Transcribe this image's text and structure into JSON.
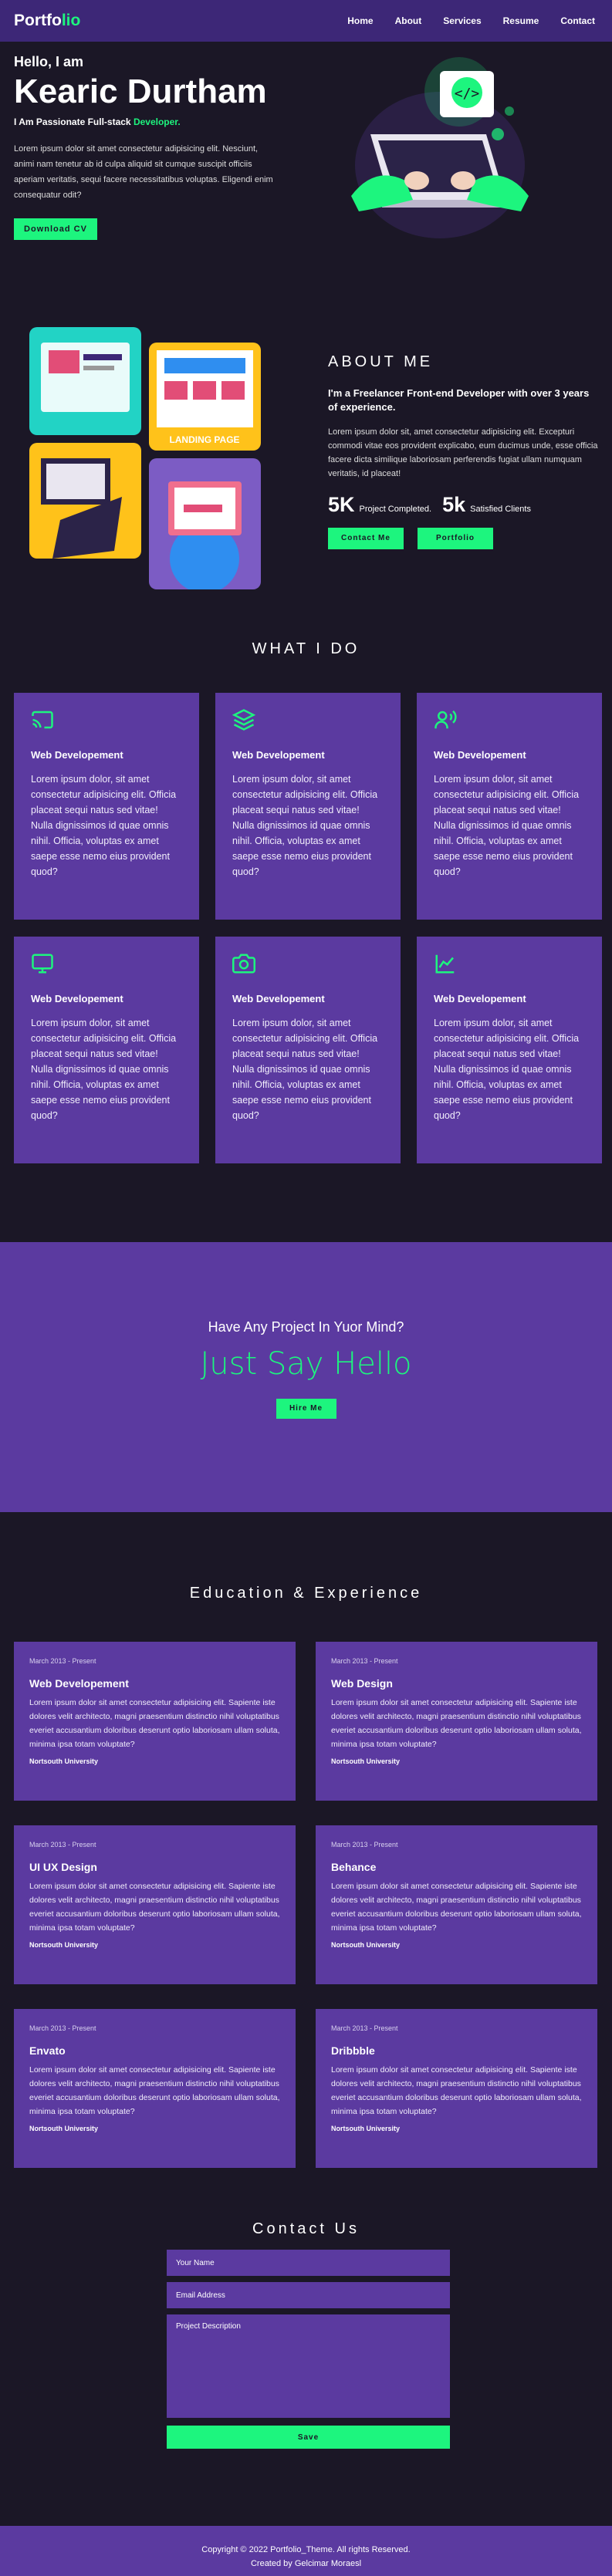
{
  "nav": {
    "logo_part1": "Portfo",
    "logo_part2": "lio",
    "items": [
      "Home",
      "About",
      "Services",
      "Resume",
      "Contact"
    ]
  },
  "hero": {
    "greeting": "Hello, I am",
    "name": "Kearic Durtham",
    "role_prefix": "I Am Passionate Full-stack",
    "role_highlight": "Developer.",
    "description": "Lorem ipsum dolor sit amet consectetur adipisicing elit. Nesciunt, animi nam tenetur ab id culpa aliquid sit cumque suscipit officiis aperiam veritatis, sequi facere necessitatibus voluptas. Eligendi enim consequatur odit?",
    "cta": "Download CV"
  },
  "about": {
    "title": "ABOUT ME",
    "lead": "I'm a Freelancer Front-end Developer with over 3 years of experience.",
    "description": "Lorem ipsum dolor sit, amet consectetur adipisicing elit. Excepturi commodi vitae eos provident explicabo, eum ducimus unde, esse officia facere dicta similique laboriosam perferendis fugiat ullam numquam veritatis, id placeat!",
    "collage_label": "LANDING PAGE",
    "stats": [
      {
        "value": "5K",
        "label": "Project Completed."
      },
      {
        "value": "5k",
        "label": "Satisfied Clients"
      }
    ],
    "buttons": [
      "Contact Me",
      "Portfolio"
    ]
  },
  "services": {
    "title": "WHAT I DO",
    "cards": [
      {
        "icon": "cast-icon",
        "title": "Web Developement",
        "desc": "Lorem ipsum dolor, sit amet consectetur adipisicing elit. Officia placeat sequi natus sed vitae! Nulla dignissimos id quae omnis nihil. Officia, voluptas ex amet saepe esse nemo eius provident quod?"
      },
      {
        "icon": "layers-icon",
        "title": "Web Developement",
        "desc": "Lorem ipsum dolor, sit amet consectetur adipisicing elit. Officia placeat sequi natus sed vitae! Nulla dignissimos id quae omnis nihil. Officia, voluptas ex amet saepe esse nemo eius provident quod?"
      },
      {
        "icon": "voice-user-icon",
        "title": "Web Developement",
        "desc": "Lorem ipsum dolor, sit amet consectetur adipisicing elit. Officia placeat sequi natus sed vitae! Nulla dignissimos id quae omnis nihil. Officia, voluptas ex amet saepe esse nemo eius provident quod?"
      },
      {
        "icon": "monitor-icon",
        "title": "Web Developement",
        "desc": "Lorem ipsum dolor, sit amet consectetur adipisicing elit. Officia placeat sequi natus sed vitae! Nulla dignissimos id quae omnis nihil. Officia, voluptas ex amet saepe esse nemo eius provident quod?"
      },
      {
        "icon": "camera-icon",
        "title": "Web Developement",
        "desc": "Lorem ipsum dolor, sit amet consectetur adipisicing elit. Officia placeat sequi natus sed vitae! Nulla dignissimos id quae omnis nihil. Officia, voluptas ex amet saepe esse nemo eius provident quod?"
      },
      {
        "icon": "line-chart-icon",
        "title": "Web Developement",
        "desc": "Lorem ipsum dolor, sit amet consectetur adipisicing elit. Officia placeat sequi natus sed vitae! Nulla dignissimos id quae omnis nihil. Officia, voluptas ex amet saepe esse nemo eius provident quod?"
      }
    ]
  },
  "hire": {
    "question": "Have Any Project In Yuor Mind?",
    "headline": "Just Say Hello",
    "button": "Hire Me"
  },
  "education": {
    "title": "Education & Experience",
    "items": [
      {
        "date": "March 2013 - Present",
        "title": "Web Developement",
        "desc": "Lorem ipsum dolor sit amet consectetur adipisicing elit. Sapiente iste dolores velit architecto, magni praesentium distinctio nihil voluptatibus everiet accusantium doloribus deserunt optio laboriosam ullam soluta, minima ipsa totam voluptate?",
        "school": "Nortsouth University"
      },
      {
        "date": "March 2013 - Present",
        "title": "Web Design",
        "desc": "Lorem ipsum dolor sit amet consectetur adipisicing elit. Sapiente iste dolores velit architecto, magni praesentium distinctio nihil voluptatibus everiet accusantium doloribus deserunt optio laboriosam ullam soluta, minima ipsa totam voluptate?",
        "school": "Nortsouth University"
      },
      {
        "date": "March 2013 - Present",
        "title": "UI UX Design",
        "desc": "Lorem ipsum dolor sit amet consectetur adipisicing elit. Sapiente iste dolores velit architecto, magni praesentium distinctio nihil voluptatibus everiet accusantium doloribus deserunt optio laboriosam ullam soluta, minima ipsa totam voluptate?",
        "school": "Nortsouth University"
      },
      {
        "date": "March 2013 - Present",
        "title": "Behance",
        "desc": "Lorem ipsum dolor sit amet consectetur adipisicing elit. Sapiente iste dolores velit architecto, magni praesentium distinctio nihil voluptatibus everiet accusantium doloribus deserunt optio laboriosam ullam soluta, minima ipsa totam voluptate?",
        "school": "Nortsouth University"
      },
      {
        "date": "March 2013 - Present",
        "title": "Envato",
        "desc": "Lorem ipsum dolor sit amet consectetur adipisicing elit. Sapiente iste dolores velit architecto, magni praesentium distinctio nihil voluptatibus everiet accusantium doloribus deserunt optio laboriosam ullam soluta, minima ipsa totam voluptate?",
        "school": "Nortsouth University"
      },
      {
        "date": "March 2013 - Present",
        "title": "Dribbble",
        "desc": "Lorem ipsum dolor sit amet consectetur adipisicing elit. Sapiente iste dolores velit architecto, magni praesentium distinctio nihil voluptatibus everiet accusantium doloribus deserunt optio laboriosam ullam soluta, minima ipsa totam voluptate?",
        "school": "Nortsouth University"
      }
    ]
  },
  "contact": {
    "title": "Contact Us",
    "name_placeholder": "Your Name",
    "email_placeholder": "Email Address",
    "desc_placeholder": "Project Description",
    "submit": "Save"
  },
  "footer": {
    "copyright": "Copyright © 2022 Portfolio_Theme. All rights Reserved.",
    "credit": "Created by Gelcimar Moraesl"
  },
  "colors": {
    "background": "#1b1726",
    "nav": "#3d2777",
    "card": "#5b3aa0",
    "accent": "#1df57e"
  }
}
